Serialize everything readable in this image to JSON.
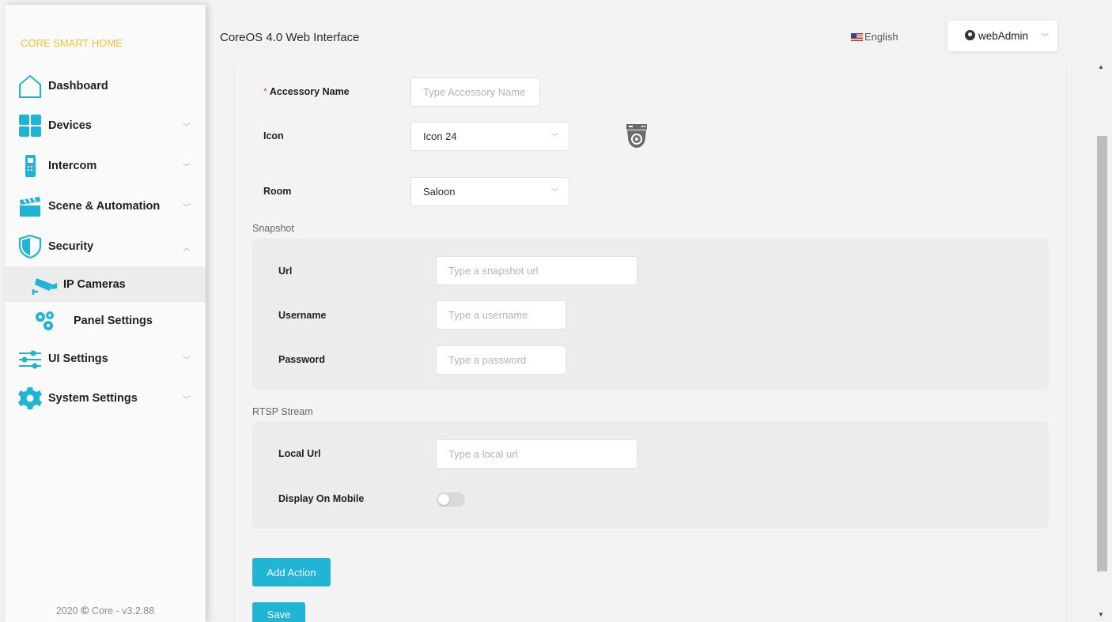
{
  "sidebar": {
    "brand": "CORE SMART HOME",
    "items": [
      {
        "label": "Dashboard",
        "icon": "home-icon"
      },
      {
        "label": "Devices",
        "icon": "grid-icon"
      },
      {
        "label": "Intercom",
        "icon": "intercom-icon"
      },
      {
        "label": "Scene & Automation",
        "icon": "clapperboard-icon"
      },
      {
        "label": "Security",
        "icon": "shield-icon"
      },
      {
        "label": "UI Settings",
        "icon": "sliders-icon"
      },
      {
        "label": "System Settings",
        "icon": "gear-icon"
      }
    ],
    "sub_items": [
      {
        "label": "IP Cameras",
        "icon": "camera-icon",
        "active": true
      },
      {
        "label": "Panel Settings",
        "icon": "gears-icon",
        "active": false
      }
    ],
    "footer_year": "2020",
    "footer_symbol": "©",
    "footer_text": "Core - v3.2.88"
  },
  "header": {
    "title": "CoreOS 4.0 Web Interface",
    "language": "English",
    "user": "webAdmin"
  },
  "form": {
    "accessory_name": {
      "label": "Accessory Name",
      "required_mark": "*",
      "placeholder": "Type Accessory Name"
    },
    "icon": {
      "label": "Icon",
      "value": "Icon 24"
    },
    "room": {
      "label": "Room",
      "value": "Saloon"
    },
    "snapshot": {
      "title": "Snapshot",
      "url": {
        "label": "Url",
        "placeholder": "Type a snapshot url"
      },
      "username": {
        "label": "Username",
        "placeholder": "Type a username"
      },
      "password": {
        "label": "Password",
        "placeholder": "Type a password"
      }
    },
    "rtsp": {
      "title": "RTSP Stream",
      "local_url": {
        "label": "Local Url",
        "placeholder": "Type a local url"
      },
      "display_on_mobile": {
        "label": "Display On Mobile",
        "value": false
      }
    },
    "add_action_label": "Add Action",
    "save_label": "Save"
  },
  "colors": {
    "accent": "#20b5d4",
    "brand": "#f5c230",
    "icon_blue": "#1fb3d4"
  }
}
